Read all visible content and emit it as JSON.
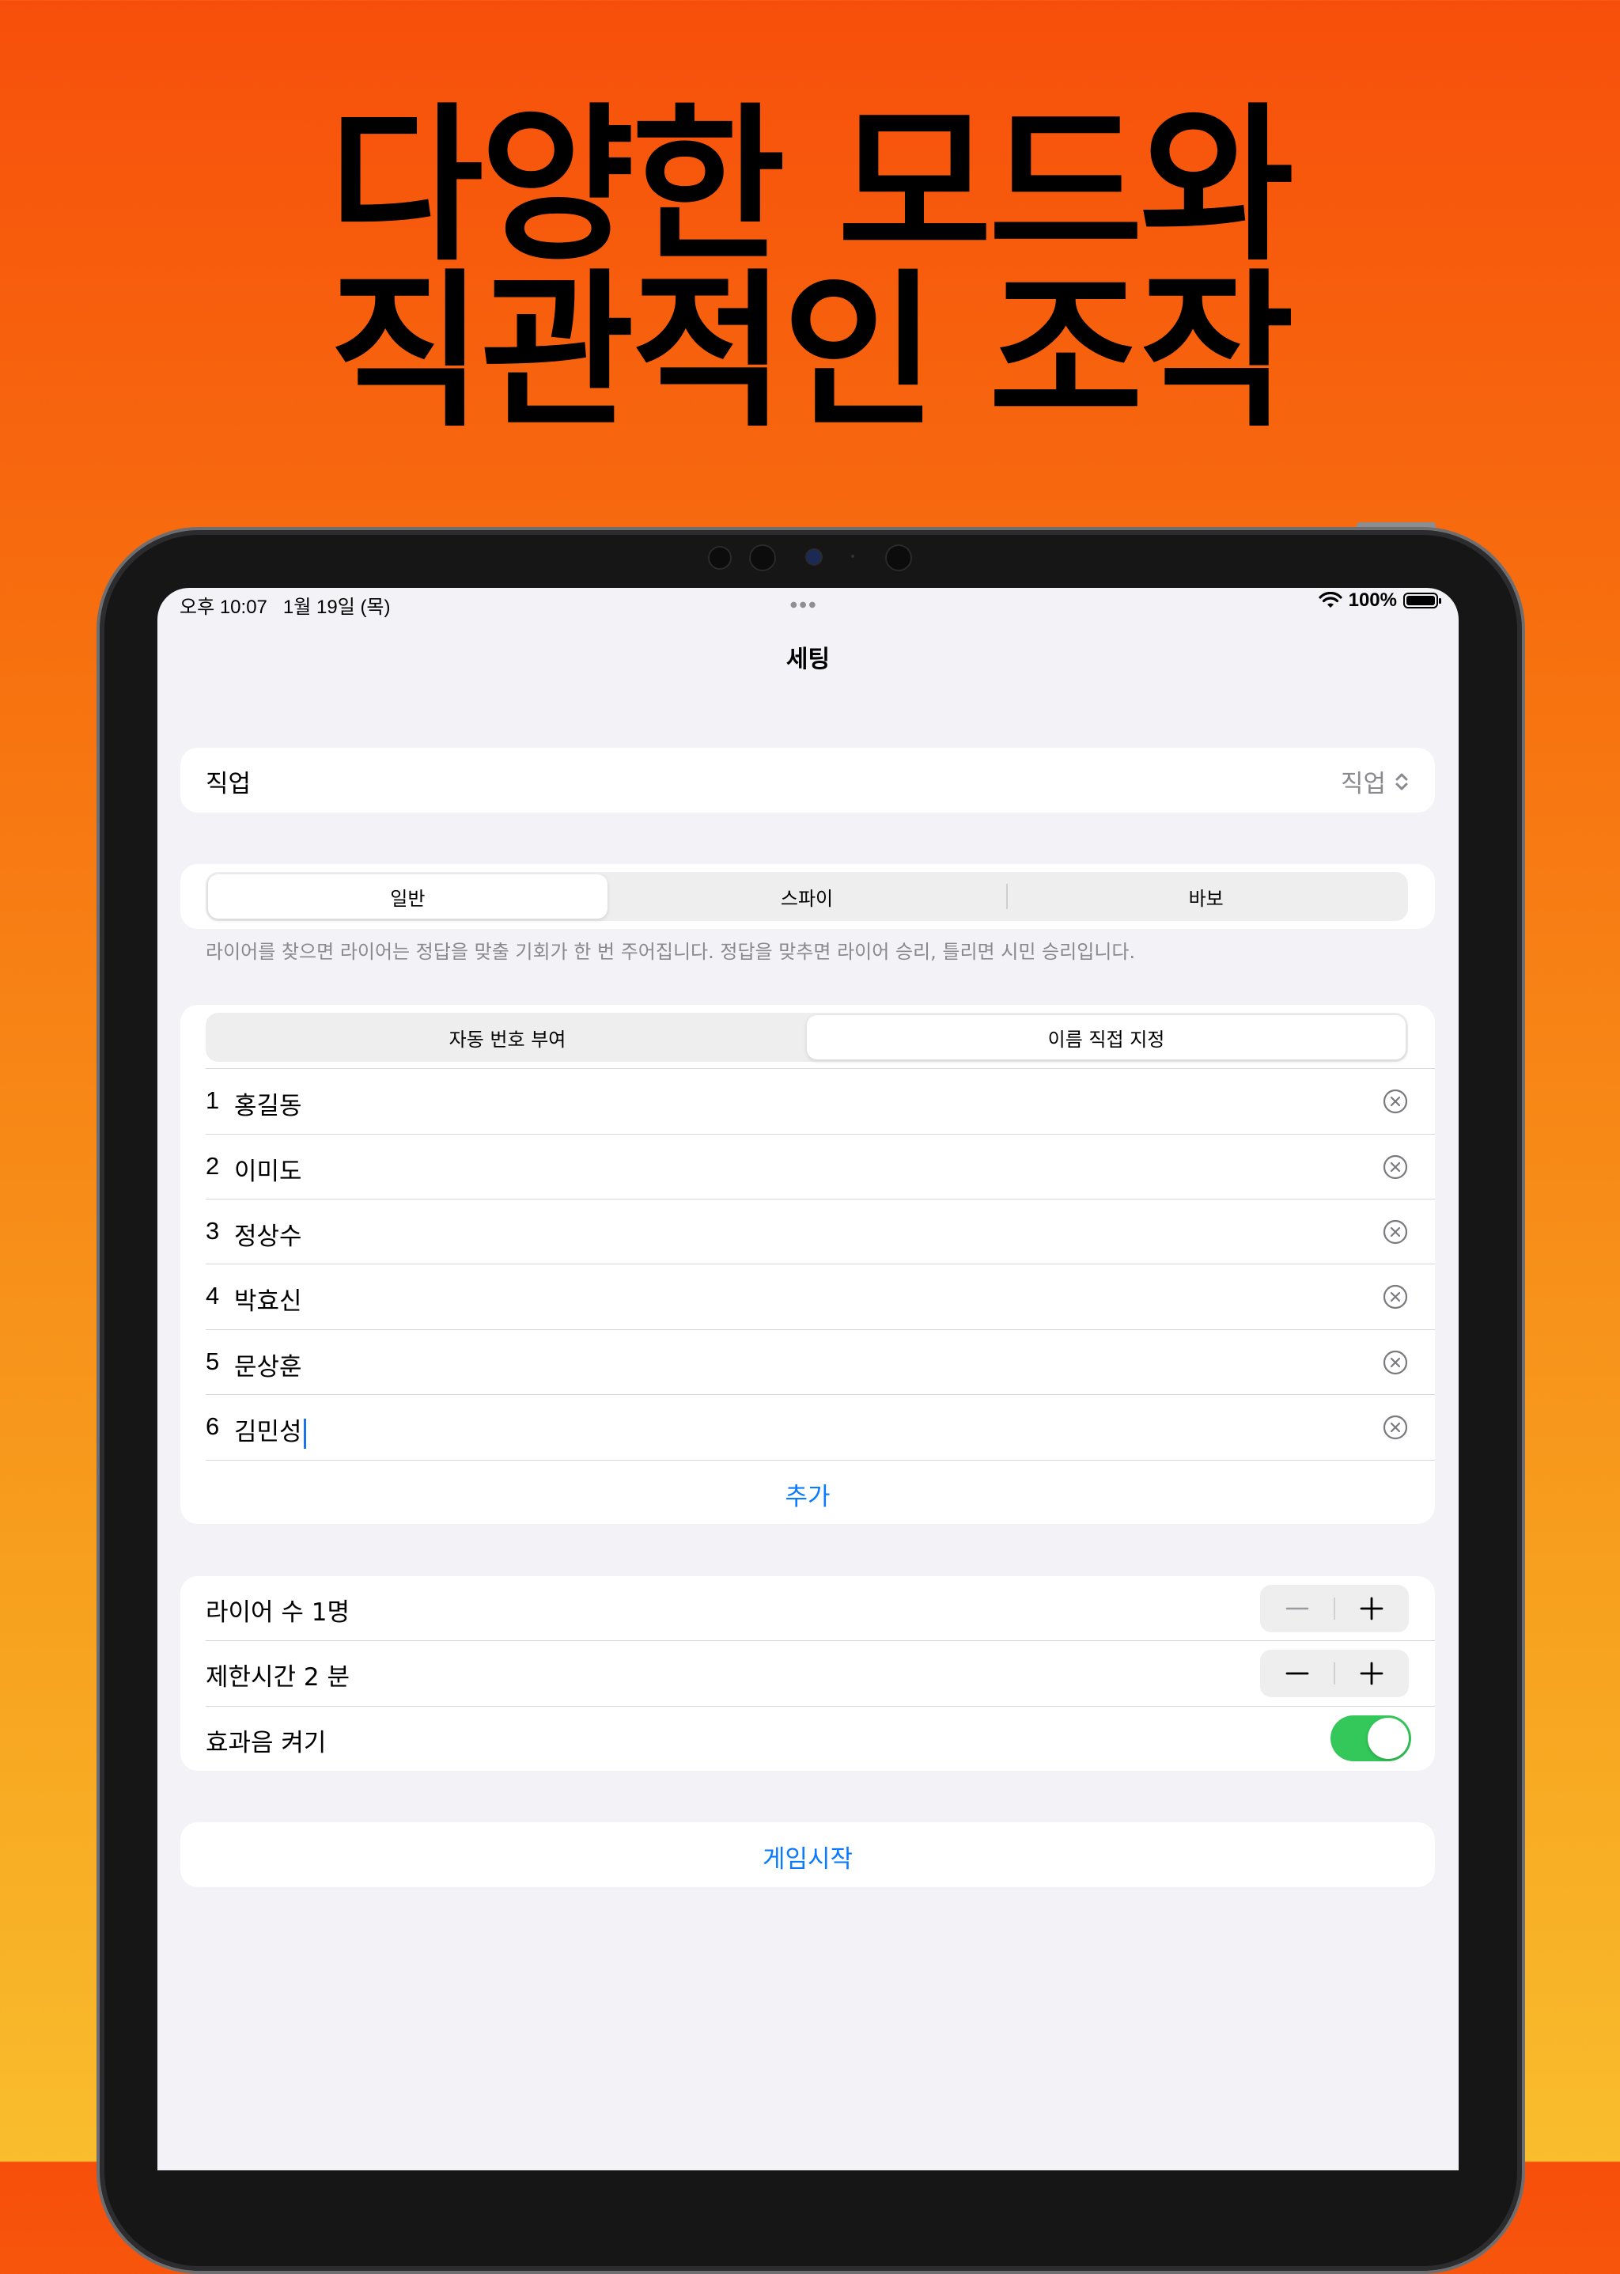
{
  "headline": {
    "line1": "다양한 모드와",
    "line2": "직관적인 조작"
  },
  "status_bar": {
    "time": "오후 10:07",
    "date": "1월 19일 (목)",
    "battery_percent": "100%",
    "battery_level": 1.0,
    "wifi_icon": "wifi-icon"
  },
  "nav": {
    "title": "세팅"
  },
  "job": {
    "label": "직업",
    "value": "직업",
    "icon": "chevron-updown-icon"
  },
  "mode": {
    "options": [
      "일반",
      "스파이",
      "바보"
    ],
    "selected": "일반",
    "description": "라이어를 찾으면 라이어는 정답을 맞출 기회가 한 번 주어집니다. 정답을 맞추면 라이어 승리, 틀리면 시민 승리입니다."
  },
  "naming": {
    "options": [
      "자동 번호 부여",
      "이름 직접 지정"
    ],
    "selected": "이름 직접 지정",
    "players": [
      {
        "num": "1",
        "name": "홍길동"
      },
      {
        "num": "2",
        "name": "이미도"
      },
      {
        "num": "3",
        "name": "정상수"
      },
      {
        "num": "4",
        "name": "박효신"
      },
      {
        "num": "5",
        "name": "문상훈"
      },
      {
        "num": "6",
        "name": "김민성"
      }
    ],
    "add_label": "추가"
  },
  "settings": {
    "liar_count_label": "라이어 수 1명",
    "time_limit_label": "제한시간 2 분",
    "sound_label": "효과음 켜기",
    "sound_on": true
  },
  "start": {
    "label": "게임시작"
  },
  "colors": {
    "accent": "#0a7aff",
    "toggle_on": "#34c759",
    "background_top": "#f74f0b",
    "background_bottom": "#f9bd2d"
  }
}
